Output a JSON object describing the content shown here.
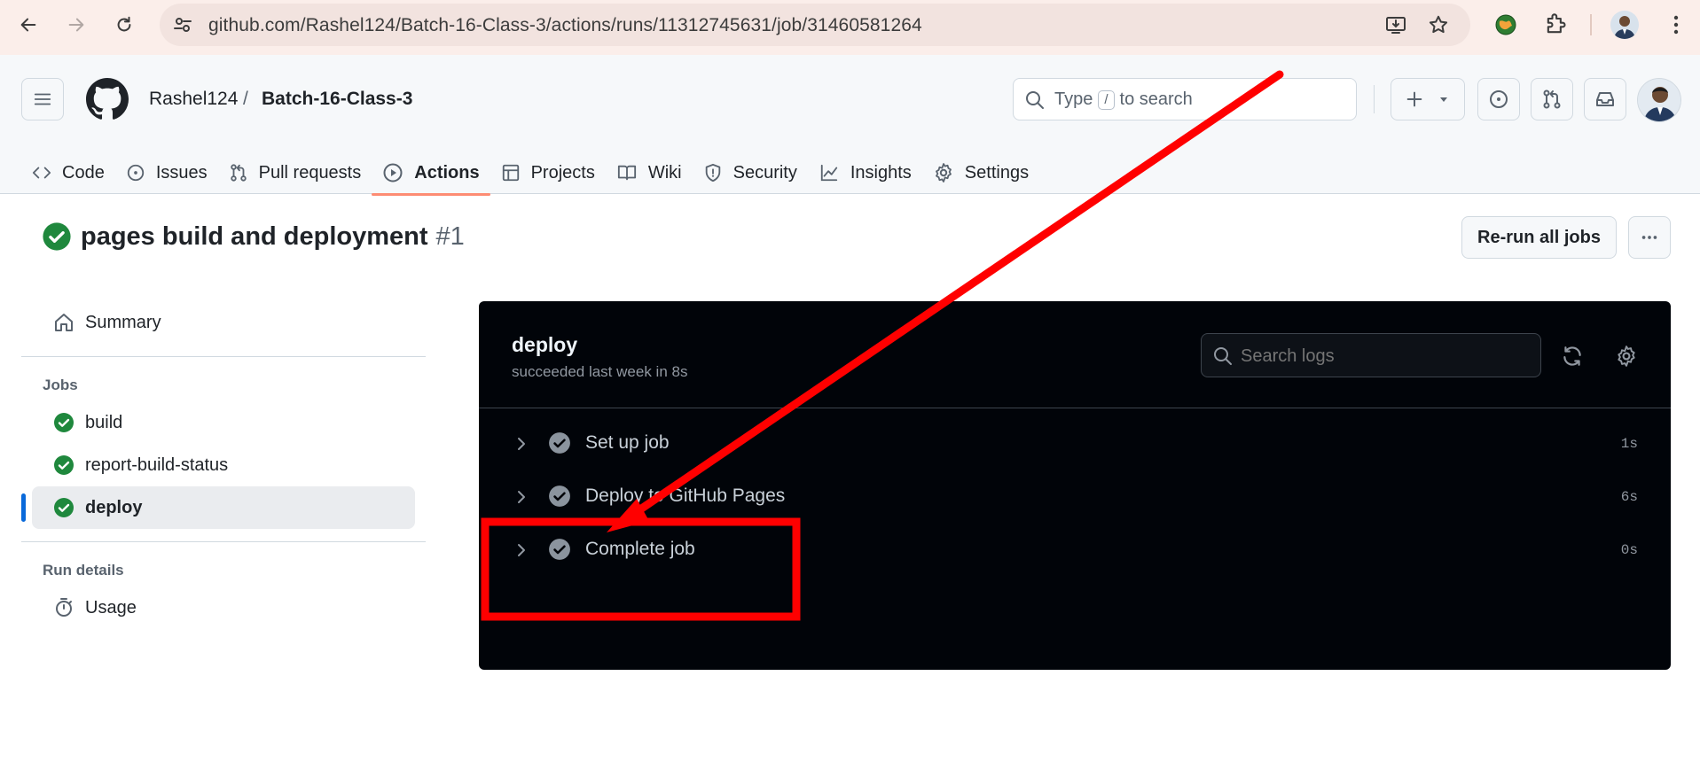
{
  "browser": {
    "url": "github.com/Rashel124/Batch-16-Class-3/actions/runs/11312745631/job/31460581264",
    "icons": [
      "back-icon",
      "forward-icon",
      "reload-icon",
      "site-settings-icon",
      "install-app-icon",
      "bookmark-star-icon",
      "extension-globe-icon",
      "extensions-puzzle-icon",
      "profile-avatar",
      "browser-menu-icon"
    ]
  },
  "header": {
    "owner": "Rashel124",
    "separator": "/",
    "repo": "Batch-16-Class-3",
    "search_prefix": "Type",
    "search_key": "/",
    "search_suffix": "to search"
  },
  "tabs": [
    {
      "label": "Code",
      "icon": "code-icon"
    },
    {
      "label": "Issues",
      "icon": "issue-icon"
    },
    {
      "label": "Pull requests",
      "icon": "pull-request-icon"
    },
    {
      "label": "Actions",
      "icon": "play-icon",
      "active": true
    },
    {
      "label": "Projects",
      "icon": "table-icon"
    },
    {
      "label": "Wiki",
      "icon": "book-icon"
    },
    {
      "label": "Security",
      "icon": "shield-icon"
    },
    {
      "label": "Insights",
      "icon": "graph-icon"
    },
    {
      "label": "Settings",
      "icon": "gear-icon"
    }
  ],
  "run": {
    "title": "pages build and deployment",
    "number": "#1",
    "rerun_label": "Re-run all jobs",
    "status_color": "#1f883d"
  },
  "sidebar": {
    "summary_label": "Summary",
    "jobs_heading": "Jobs",
    "jobs": [
      {
        "label": "build"
      },
      {
        "label": "report-build-status"
      },
      {
        "label": "deploy",
        "active": true
      }
    ],
    "run_details_heading": "Run details",
    "usage_label": "Usage"
  },
  "log_panel": {
    "job_name": "deploy",
    "job_status": "succeeded last week in 8s",
    "search_placeholder": "Search logs",
    "steps": [
      {
        "label": "Set up job",
        "duration": "1s"
      },
      {
        "label": "Deploy to GitHub Pages",
        "duration": "6s"
      },
      {
        "label": "Complete job",
        "duration": "0s"
      }
    ]
  },
  "annotation": {
    "color": "#ff0000",
    "shapes": [
      "arrow",
      "highlight-rectangle"
    ]
  }
}
